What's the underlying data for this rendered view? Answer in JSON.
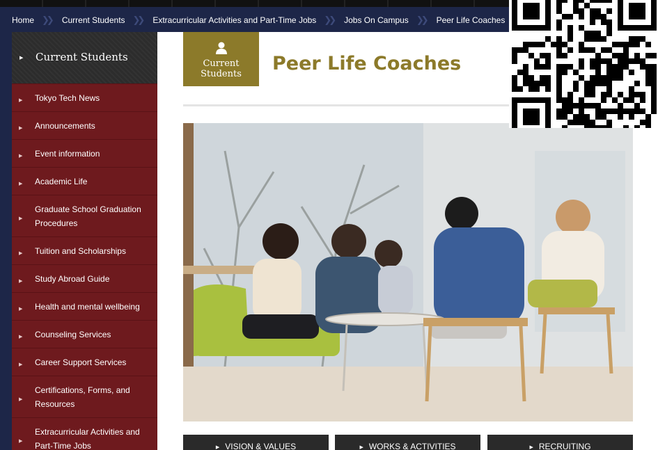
{
  "breadcrumb": {
    "items": [
      {
        "label": "Home"
      },
      {
        "label": "Current Students"
      },
      {
        "label": "Extracurricular Activities and Part-Time Jobs"
      },
      {
        "label": "Jobs On Campus"
      },
      {
        "label": "Peer Life Coaches"
      }
    ]
  },
  "sidebar": {
    "heading": "Current Students",
    "items": [
      {
        "label": "Tokyo Tech News"
      },
      {
        "label": "Announcements"
      },
      {
        "label": "Event information"
      },
      {
        "label": "Academic Life"
      },
      {
        "label": "Graduate School Graduation Procedures"
      },
      {
        "label": "Tuition and Scholarships"
      },
      {
        "label": "Study Abroad Guide"
      },
      {
        "label": "Health and mental wellbeing"
      },
      {
        "label": "Counseling Services"
      },
      {
        "label": "Career Support Services"
      },
      {
        "label": "Certifications, Forms, and Resources"
      },
      {
        "label": "Extracurricular Activities and Part-Time Jobs"
      }
    ]
  },
  "header": {
    "badge_line1": "Current",
    "badge_line2": "Students",
    "title": "Peer Life Coaches"
  },
  "nav_buttons": [
    {
      "label": "VISION & VALUES"
    },
    {
      "label": "WORKS & ACTIVITIES"
    },
    {
      "label": "RECRUITING"
    }
  ],
  "colors": {
    "navy": "#1d2648",
    "maroon": "#6e1a1e",
    "gold": "#8c7a2a",
    "dark": "#2a2a2a"
  },
  "icons": {
    "badge_icon": "person-icon",
    "bullet": "triangle-right-icon",
    "separator": "double-chevron-icon",
    "qr": "qr-code"
  }
}
